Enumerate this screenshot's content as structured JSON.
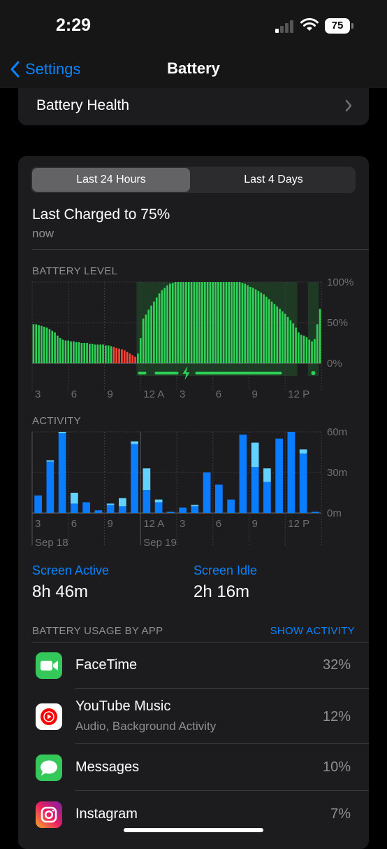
{
  "status": {
    "time": "2:29",
    "battery_level": "75"
  },
  "nav": {
    "back_label": "Settings",
    "title": "Battery"
  },
  "battery_health": {
    "label": "Battery Health"
  },
  "segmented": {
    "options": [
      "Last 24 Hours",
      "Last 4 Days"
    ],
    "selected": "Last 24 Hours"
  },
  "last_charged": {
    "title": "Last Charged to 75%",
    "subtitle": "now"
  },
  "colors": {
    "accent": "#0a84ff",
    "green": "#30d158",
    "red": "#ff453a",
    "dark_blue": "#0a7cff",
    "light_blue": "#64d2ff"
  },
  "icons": [
    "chevron-left-icon",
    "chevron-right-icon",
    "wifi-icon",
    "cellular-signal-icon",
    "charging-bolt-icon",
    "facetime-icon",
    "youtube-music-icon",
    "messages-icon",
    "instagram-icon"
  ],
  "chart_data": [
    {
      "type": "bar",
      "title": "BATTERY LEVEL",
      "ylabels": [
        "100%",
        "50%",
        "0%"
      ],
      "xlabels": [
        "3",
        "6",
        "9",
        "12 A",
        "3",
        "6",
        "9",
        "12 P"
      ],
      "ylim": [
        0,
        100
      ],
      "values": [
        48,
        48,
        47,
        46,
        45,
        44,
        42,
        40,
        38,
        34,
        31,
        29,
        28,
        28,
        27,
        27,
        26,
        26,
        25,
        25,
        25,
        24,
        24,
        23,
        23,
        23,
        23,
        22,
        22,
        21,
        20,
        19,
        18,
        17,
        16,
        14,
        12,
        10,
        8,
        12,
        31,
        55,
        60,
        66,
        71,
        76,
        81,
        86,
        90,
        93,
        96,
        98,
        99,
        100,
        100,
        100,
        100,
        100,
        100,
        100,
        100,
        100,
        100,
        100,
        100,
        100,
        100,
        100,
        100,
        100,
        100,
        100,
        100,
        100,
        100,
        100,
        100,
        100,
        99,
        98,
        96,
        94,
        93,
        91,
        89,
        87,
        85,
        82,
        79,
        76,
        73,
        70,
        67,
        64,
        61,
        57,
        53,
        49,
        44,
        38,
        35,
        34,
        32,
        29,
        27,
        30,
        48,
        67
      ],
      "low_battery_threshold": 20,
      "charging_ranges": [
        [
          39,
          98
        ],
        [
          103,
          106
        ]
      ],
      "grid": true
    },
    {
      "type": "bar",
      "title": "ACTIVITY",
      "ylabels": [
        "60m",
        "30m",
        "0m"
      ],
      "xlabels": [
        "3",
        "6",
        "9",
        "12 A",
        "3",
        "6",
        "9",
        "12 P"
      ],
      "date_labels": [
        "Sep 18",
        "Sep 19"
      ],
      "ylim": [
        0,
        60
      ],
      "series": [
        {
          "name": "Screen Active",
          "values": [
            13,
            38,
            59,
            7,
            8,
            2,
            6,
            5,
            51,
            17,
            8,
            0,
            4,
            5,
            30,
            21,
            10,
            58,
            34,
            23,
            55,
            60,
            44,
            1
          ]
        },
        {
          "name": "Screen Idle",
          "values": [
            0,
            1,
            1,
            8,
            0,
            0,
            1,
            6,
            2,
            16,
            2,
            0,
            0,
            1,
            0,
            0,
            0,
            0,
            18,
            10,
            0,
            0,
            3,
            0
          ]
        }
      ],
      "grid": true
    }
  ],
  "activity_summary": {
    "screen_active_label": "Screen Active",
    "screen_active_value": "8h 46m",
    "screen_idle_label": "Screen Idle",
    "screen_idle_value": "2h 16m"
  },
  "usage": {
    "label": "BATTERY USAGE BY APP",
    "show_activity": "SHOW ACTIVITY",
    "apps": [
      {
        "name": "FaceTime",
        "subtitle": "",
        "percent": "32%"
      },
      {
        "name": "YouTube Music",
        "subtitle": "Audio, Background Activity",
        "percent": "12%"
      },
      {
        "name": "Messages",
        "subtitle": "",
        "percent": "10%"
      },
      {
        "name": "Instagram",
        "subtitle": "",
        "percent": "7%"
      }
    ]
  }
}
